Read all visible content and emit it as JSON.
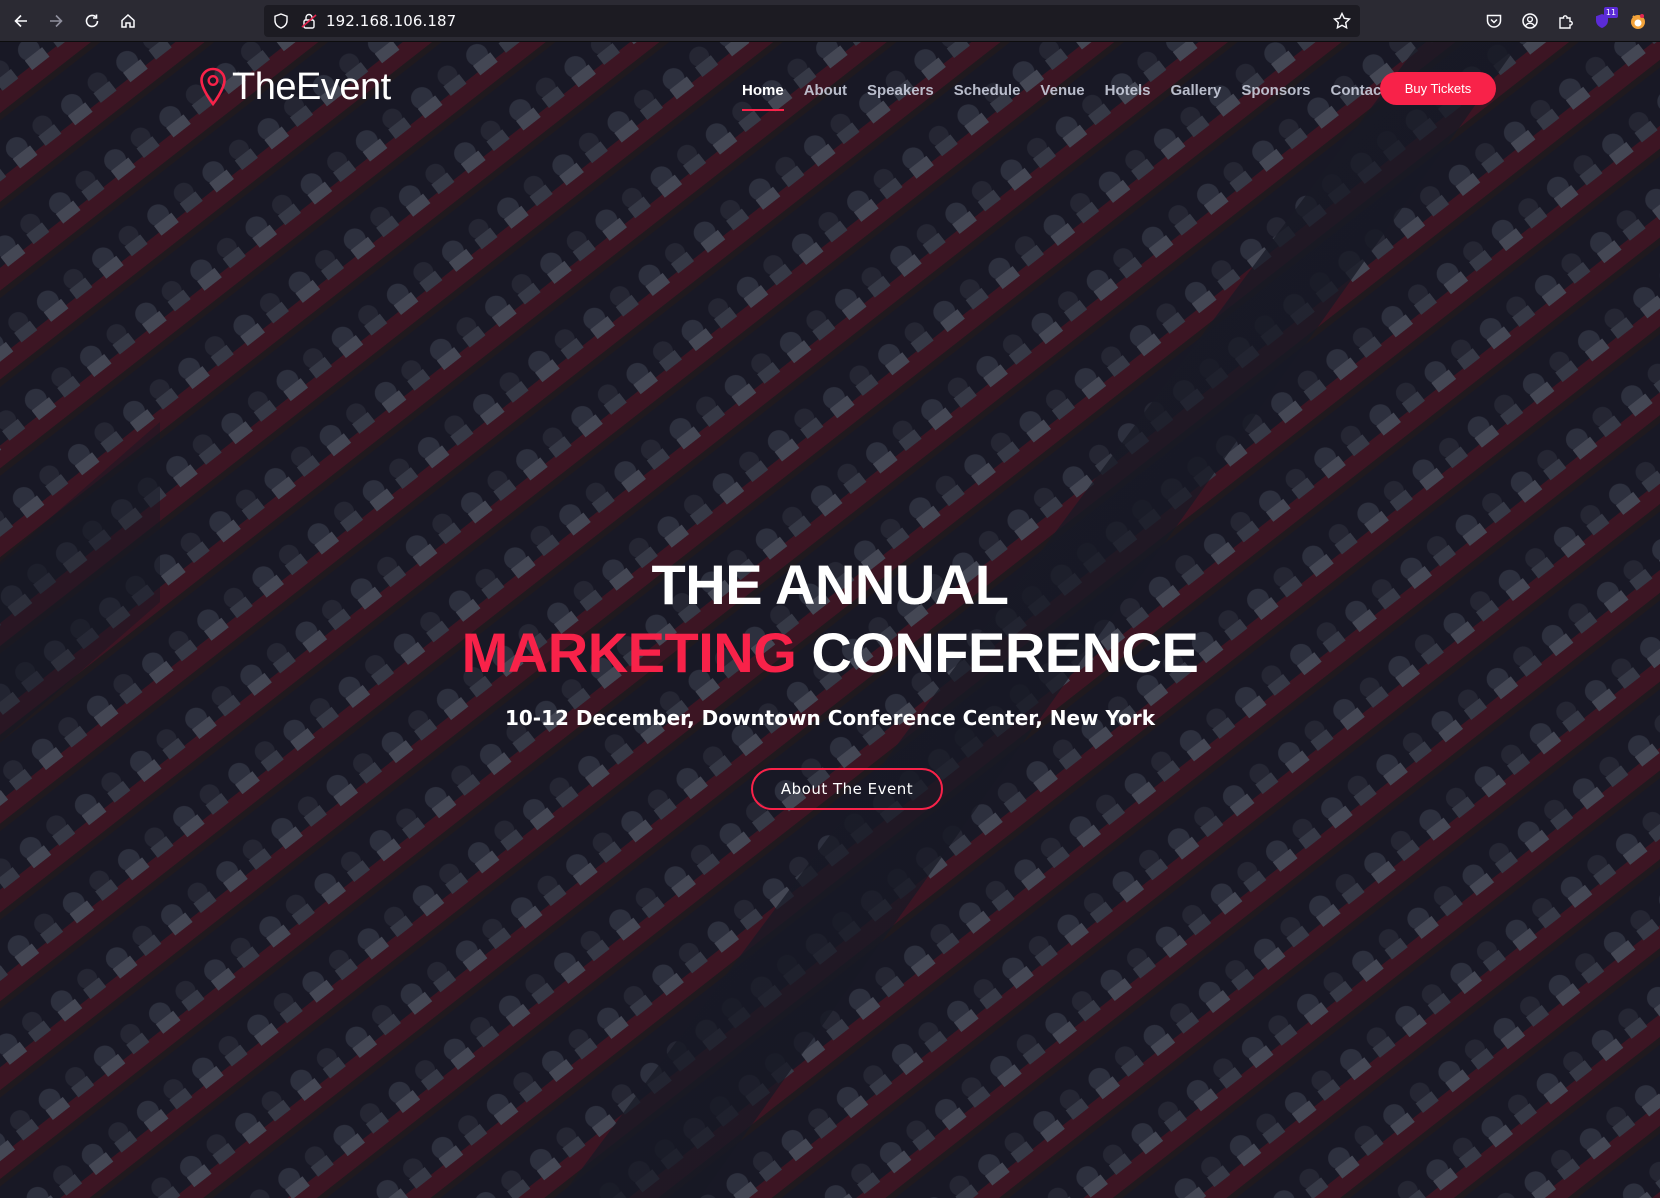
{
  "browser": {
    "url": "192.168.106.187",
    "extension_badge": "11"
  },
  "site": {
    "logo_text": "TheEvent",
    "accent_color": "#f82249",
    "nav": [
      {
        "label": "Home",
        "active": true
      },
      {
        "label": "About",
        "active": false
      },
      {
        "label": "Speakers",
        "active": false
      },
      {
        "label": "Schedule",
        "active": false
      },
      {
        "label": "Venue",
        "active": false
      },
      {
        "label": "Hotels",
        "active": false
      },
      {
        "label": "Gallery",
        "active": false
      },
      {
        "label": "Sponsors",
        "active": false
      },
      {
        "label": "Contact",
        "active": false
      }
    ],
    "buy_tickets_label": "Buy Tickets"
  },
  "hero": {
    "title_line1": "THE ANNUAL",
    "title_accent": "MARKETING",
    "title_rest": "CONFERENCE",
    "subtitle": "10-12 December, Downtown Conference Center, New York",
    "cta_label": "About The Event"
  }
}
